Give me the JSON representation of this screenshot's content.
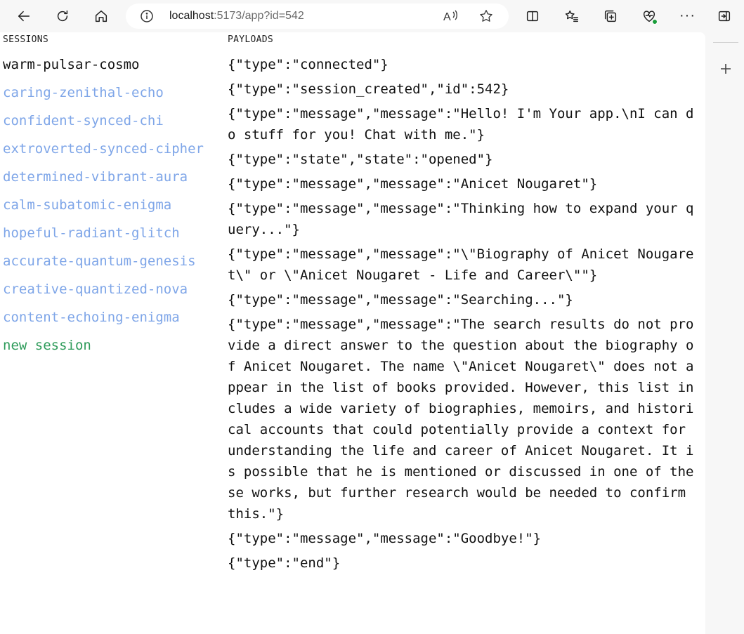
{
  "browser": {
    "url_host": "localhost",
    "url_rest": ":5173/app?id=542",
    "read_aloud_glyph": "Aͅ",
    "more_glyph": "···"
  },
  "sessions": {
    "title": "SESSIONS",
    "items": [
      {
        "label": "warm-pulsar-cosmo",
        "active": true
      },
      {
        "label": "caring-zenithal-echo"
      },
      {
        "label": "confident-synced-chi"
      },
      {
        "label": "extroverted-synced-cipher"
      },
      {
        "label": "determined-vibrant-aura"
      },
      {
        "label": "calm-subatomic-enigma"
      },
      {
        "label": "hopeful-radiant-glitch"
      },
      {
        "label": "accurate-quantum-genesis"
      },
      {
        "label": "creative-quantized-nova"
      },
      {
        "label": "content-echoing-enigma"
      }
    ],
    "new_label": "new session"
  },
  "payloads": {
    "title": "PAYLOADS",
    "items": [
      "{\"type\":\"connected\"}",
      "{\"type\":\"session_created\",\"id\":542}",
      "{\"type\":\"message\",\"message\":\"Hello! I'm Your app.\\nI can do stuff for you! Chat with me.\"}",
      "{\"type\":\"state\",\"state\":\"opened\"}",
      "{\"type\":\"message\",\"message\":\"Anicet Nougaret\"}",
      "{\"type\":\"message\",\"message\":\"Thinking how to expand your query...\"}",
      "{\"type\":\"message\",\"message\":\"\\\"Biography of Anicet Nougaret\\\" or \\\"Anicet Nougaret - Life and Career\\\"\"}",
      "{\"type\":\"message\",\"message\":\"Searching...\"}",
      "{\"type\":\"message\",\"message\":\"The search results do not provide a direct answer to the question about the biography of Anicet Nougaret. The name \\\"Anicet Nougaret\\\" does not appear in the list of books provided. However, this list includes a wide variety of biographies, memoirs, and historical accounts that could potentially provide a context for understanding the life and career of Anicet Nougaret. It is possible that he is mentioned or discussed in one of these works, but further research would be needed to confirm this.\"}",
      "{\"type\":\"message\",\"message\":\"Goodbye!\"}",
      "{\"type\":\"end\"}"
    ]
  },
  "colors": {
    "session_link": "#7fa6e8",
    "session_active": "#111111",
    "new_session": "#2e9b5a"
  }
}
